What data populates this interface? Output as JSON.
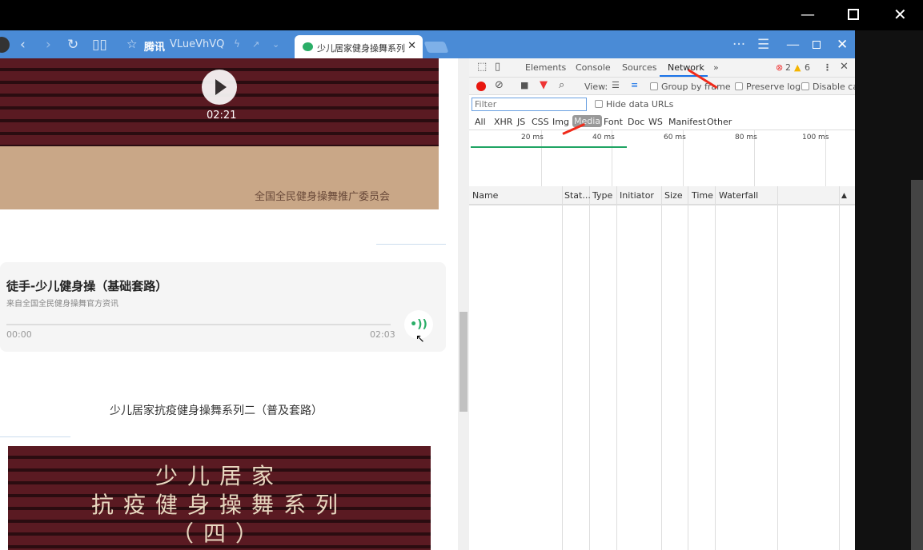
{
  "browser": {
    "bookmark_1": "腾讯",
    "bookmark_2": "VLueVhVQ",
    "tab_title": "少儿居家健身操舞系列"
  },
  "page": {
    "video1": {
      "duration": "02:21",
      "watermark": "全国全民健身操舞推广委员会"
    },
    "audio": {
      "title": "徒手-少儿健身操（基础套路）",
      "source": "来自全国全民健身操舞官方资讯",
      "current": "00:00",
      "total": "02:03",
      "progress": 0
    },
    "section_title": "少儿居家抗疫健身操舞系列二（普及套路）",
    "video2": {
      "lines": [
        "少儿居家",
        "抗疫健身操舞系列",
        "（四）"
      ]
    }
  },
  "devtools": {
    "tabs": [
      "Elements",
      "Console",
      "Sources",
      "Network"
    ],
    "more": "»",
    "errors": "2",
    "warnings": "6",
    "view_label": "View:",
    "group_by_frame": "Group by frame",
    "preserve_log": "Preserve log",
    "disable_cache": "Disable cac",
    "filter_placeholder": "Filter",
    "hide_data_urls": "Hide data URLs",
    "types": [
      "All",
      "XHR",
      "JS",
      "CSS",
      "Img",
      "Media",
      "Font",
      "Doc",
      "WS",
      "Manifest",
      "Other"
    ],
    "ticks": [
      "20 ms",
      "40 ms",
      "60 ms",
      "80 ms",
      "100 ms"
    ],
    "columns": [
      "Name",
      "Stat...",
      "Type",
      "Initiator",
      "Size",
      "Time",
      "Waterfall"
    ],
    "sort_indicator": "▲",
    "colors": {
      "record": "#e8170f",
      "accent": "#1a73e8"
    }
  }
}
